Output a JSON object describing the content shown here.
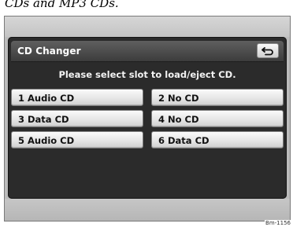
{
  "caption": "CDs and MP3 CDs.",
  "window": {
    "title": "CD Changer"
  },
  "instruction": "Please select slot to load/eject CD.",
  "slots": [
    {
      "label": "1 Audio CD"
    },
    {
      "label": "2 No CD"
    },
    {
      "label": "3 Data CD"
    },
    {
      "label": "4 No CD"
    },
    {
      "label": "5 Audio CD"
    },
    {
      "label": "6 Data CD"
    }
  ],
  "icons": {
    "back": "back-arrow-icon"
  },
  "reference_code": "Bm-1156",
  "colors": {
    "panel": "#2b2b2b",
    "title_bar": "#4a4a4a",
    "button": "#e6e6e6",
    "bezel": "#bcbcbc"
  }
}
